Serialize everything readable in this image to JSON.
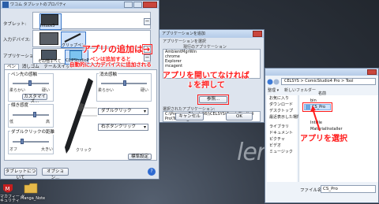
{
  "wacom": {
    "title": "ワコム タブレットのプロパティ",
    "tablet_label": "タブレット:",
    "input_device_label": "入力デバイス:",
    "app_label": "アプリケーション:",
    "tablet_name": "Intuos5",
    "pen_name": "グリップペン",
    "app_other": "その他すべて",
    "app_csp": "CLIPStudioP",
    "tab_pen": "ペン",
    "tab_eraser": "消しゴム",
    "tab_other": "テールスイッチ",
    "tip_group": "ペン先の感触",
    "soft": "柔らかい",
    "firm": "硬い",
    "customize": "カスタマイズ...",
    "tilt_label": "傾き感度",
    "tilt_low": "低",
    "tilt_high": "高",
    "double_click_group": "ダブルクリックの距離",
    "off": "オフ",
    "large": "大きい",
    "side_group": "消去感触",
    "dd_double_click": "ダブルクリック",
    "dd_right_click": "右ボタンクリック",
    "click_label": "クリック",
    "default_button": "標準設定",
    "about_button": "タブレットについて",
    "options_button": "オプション...",
    "help_icon": "?"
  },
  "appdlg": {
    "title": "アプリケーションを追加",
    "select_label": "アプリケーションを選択",
    "running_label": "現行のアプリケーション",
    "running_apps": [
      "AmbientMgrWin",
      "chrome",
      "Explorer",
      "mcagent"
    ],
    "selected_label": "選択されたアプリケーション:",
    "browse_button": "参照...",
    "path": "C:\\Program Files (x86)\\CELSYS\\ComicStudio4 Pro\\Tool\\CS_Pro.exe",
    "cancel_button": "キャンセル",
    "ok_button": "OK"
  },
  "filedlg": {
    "address": "CELSYS > ComicStudio4 Pro > Tool",
    "organize": "整理 ▾",
    "new_folder": "新しいフォルダー",
    "column_name": "名前",
    "nav_items": [
      "お気に入り",
      "ダウンロード",
      "デスクトップ",
      "最近表示した場所",
      "ライブラリ",
      "ドキュメント",
      "ピクチャ",
      "ビデオ",
      "ミュージック"
    ],
    "files": [
      "bin",
      "CS_Pro",
      "IntFile",
      "MaterialInstaller"
    ],
    "filename_label": "ファイル名(N):",
    "filename_value": "CS_Pro"
  },
  "annotations": {
    "add_app": "アプリの追加は→",
    "auto_add": "ペンは追加すると\n自動的に入力デバイスに追加される",
    "browse_hint": "アプリを開いてなければ\n↓を押して",
    "select_app": "アプリを選択"
  },
  "desktop": {
    "brand": "lenovo",
    "icon1_label": "マカフィー セ\nキュリティ",
    "icon2_label": "Manga_Note"
  },
  "colors": {
    "annotation": "#ff1a1a",
    "title_bar": "#b4cbe8"
  }
}
